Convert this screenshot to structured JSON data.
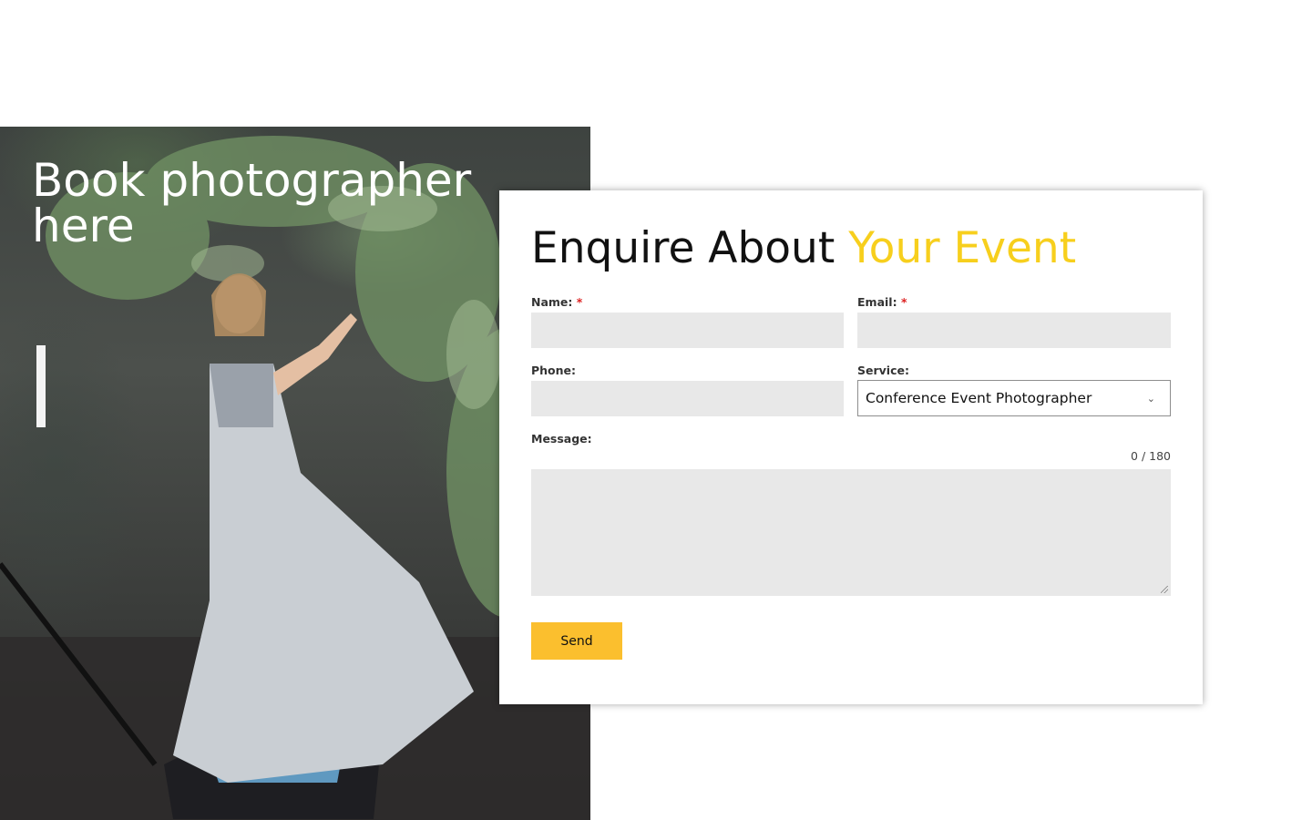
{
  "hero": {
    "title": "Book photographer here"
  },
  "form": {
    "title_main": "Enquire About ",
    "title_accent": "Your Event",
    "name_label": "Name:",
    "email_label": "Email:",
    "phone_label": "Phone:",
    "service_label": "Service:",
    "message_label": "Message:",
    "required_mark": "*",
    "service_value": "Conference Event Photographer",
    "message_counter": "0 / 180",
    "send_label": "Send"
  },
  "colors": {
    "accent": "#f7cf1d",
    "button": "#fbbf2e",
    "input_bg": "#e8e8e8"
  }
}
